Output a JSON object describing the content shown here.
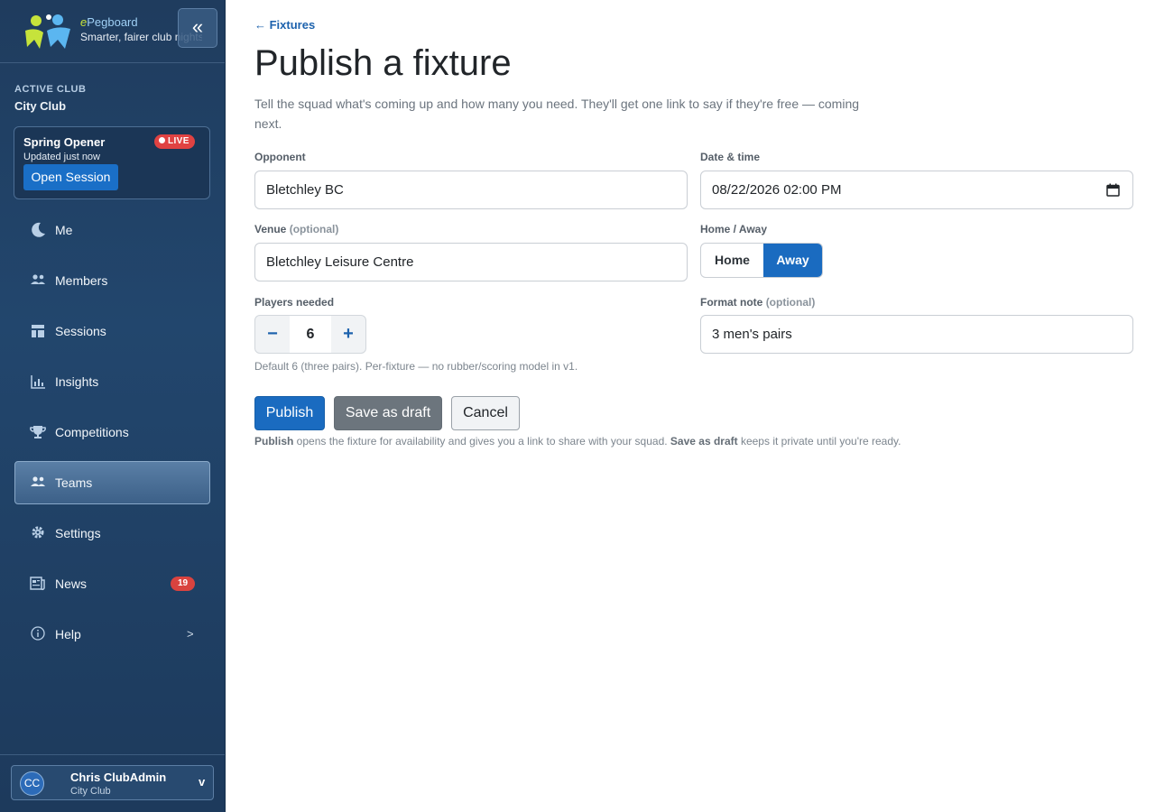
{
  "brand": {
    "name_prefix": "e",
    "name_rest": "Pegboard",
    "tagline": "Smarter, fairer club nights",
    "collapse_icon": "«"
  },
  "sidebar": {
    "active_club_label": "ACTIVE CLUB",
    "active_club_name": "City Club",
    "session": {
      "title": "Spring Opener",
      "live_label": "LIVE",
      "updated": "Updated just now",
      "open_button": "Open Session"
    },
    "items": [
      {
        "label": "Me",
        "icon": "moon-icon"
      },
      {
        "label": "Members",
        "icon": "people-icon"
      },
      {
        "label": "Sessions",
        "icon": "layout-icon"
      },
      {
        "label": "Insights",
        "icon": "bar-chart-icon"
      },
      {
        "label": "Competitions",
        "icon": "trophy-icon"
      },
      {
        "label": "Teams",
        "icon": "people-icon",
        "active": true
      },
      {
        "label": "Settings",
        "icon": "gear-icon"
      },
      {
        "label": "News",
        "icon": "newspaper-icon",
        "badge": "19"
      },
      {
        "label": "Help",
        "icon": "info-icon",
        "chevron": ">"
      }
    ],
    "user": {
      "initials": "CC",
      "name": "Chris ClubAdmin",
      "club": "City Club",
      "chevron": "v"
    }
  },
  "main": {
    "back_link": "← Fixtures",
    "title": "Publish a fixture",
    "description": "Tell the squad what's coming up and how many you need. They'll get one link to say if they're free — coming next.",
    "form": {
      "opponent_label": "Opponent",
      "opponent_value": "Bletchley BC",
      "datetime_label": "Date & time",
      "datetime_value": "08/22/2026 02:00 PM",
      "venue_label": "Venue",
      "venue_optional": "(optional)",
      "venue_value": "Bletchley Leisure Centre",
      "home_away_label": "Home / Away",
      "home_option": "Home",
      "away_option": "Away",
      "home_away_selected": "Away",
      "players_label": "Players needed",
      "players_value": "6",
      "minus": "−",
      "plus": "+",
      "players_hint": "Default 6 (three pairs). Per-fixture — no rubber/scoring model in v1.",
      "format_label": "Format note",
      "format_optional": "(optional)",
      "format_value": "3 men's pairs"
    },
    "actions": {
      "publish": "Publish",
      "save_draft": "Save as draft",
      "cancel": "Cancel",
      "help_publish": "Publish",
      "help_text_1": " opens the fixture for availability and gives you a link to share with your squad. ",
      "help_save": "Save as draft",
      "help_text_2": " keeps it private until you're ready."
    }
  },
  "colors": {
    "accent": "#1a6bc0",
    "sidebar_bg": "#22466d",
    "live": "#e04242"
  }
}
